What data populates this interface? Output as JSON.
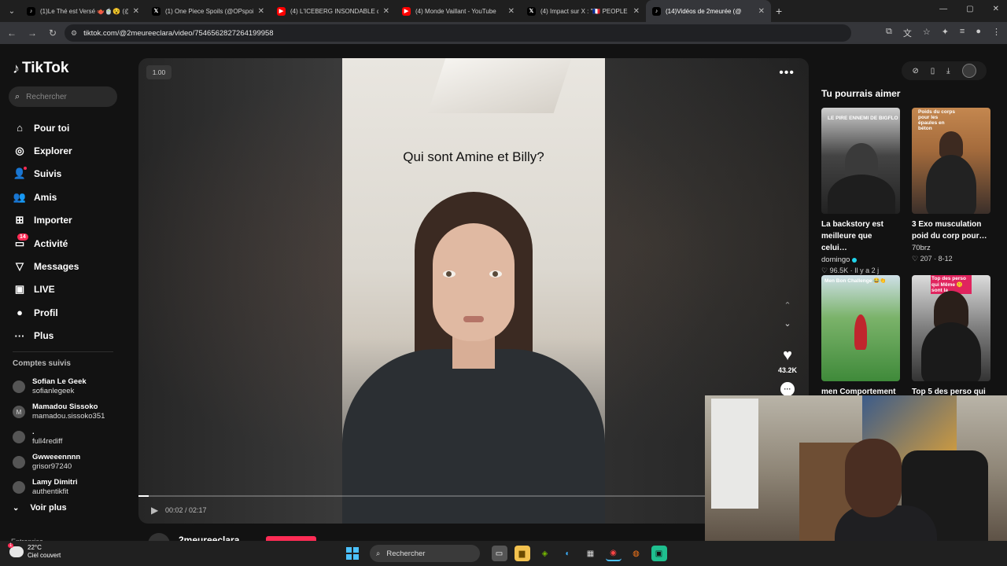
{
  "browser": {
    "tabs": [
      {
        "title": "(1)Le Thé est Versé 🫖🍵😵 (@",
        "favicon": "tiktok"
      },
      {
        "title": "(1) One Piece Spoils (@OPspoi",
        "favicon": "x"
      },
      {
        "title": "(4) L'ICEBERG INSONDABLE de",
        "favicon": "youtube"
      },
      {
        "title": "(4) Monde Vaillant - YouTube",
        "favicon": "youtube"
      },
      {
        "title": "(4) Impact sur X : \"🇫🇷 PEOPLE | A",
        "favicon": "x"
      },
      {
        "title": "(14)Vidéos de 2meurée (@",
        "favicon": "tiktok",
        "active": true
      }
    ],
    "url": "tiktok.com/@2meureeclara/video/7546562827264199958"
  },
  "tiktok": {
    "logo": "TikTok",
    "search_placeholder": "Rechercher",
    "nav": [
      {
        "label": "Pour toi",
        "icon": "home-icon",
        "glyph": "⌂"
      },
      {
        "label": "Explorer",
        "icon": "compass-icon",
        "glyph": "◎"
      },
      {
        "label": "Suivis",
        "icon": "following-icon",
        "glyph": "👤"
      },
      {
        "label": "Amis",
        "icon": "friends-icon",
        "glyph": "👥"
      },
      {
        "label": "Importer",
        "icon": "upload-icon",
        "glyph": "⊞"
      },
      {
        "label": "Activité",
        "icon": "activity-icon",
        "glyph": "▭",
        "badge": "14"
      },
      {
        "label": "Messages",
        "icon": "messages-icon",
        "glyph": "▽"
      },
      {
        "label": "LIVE",
        "icon": "live-icon",
        "glyph": "▣"
      },
      {
        "label": "Profil",
        "icon": "profile-icon",
        "glyph": "●"
      },
      {
        "label": "Plus",
        "icon": "more-icon",
        "glyph": "···"
      }
    ],
    "followed_title": "Comptes suivis",
    "followed": [
      {
        "name": "Sofian Le Geek",
        "username": "sofianlegeek",
        "initial": ""
      },
      {
        "name": "Mamadou Sissoko",
        "username": "mamadou.sissoko351",
        "initial": "M"
      },
      {
        "name": ".",
        "username": "full4rediff",
        "initial": ""
      },
      {
        "name": "Gwweeennnn",
        "username": "grisor97240",
        "initial": ""
      },
      {
        "name": "Lamy Dimitri",
        "username": "authentikfit",
        "initial": ""
      }
    ],
    "see_more": "Voir plus",
    "footer_partial": "Entreprise",
    "video": {
      "speed": "1.00",
      "caption": "Qui sont Amine et Billy?",
      "likes": "43.2K",
      "time": "00:02 / 02:17",
      "progress": 0.015,
      "author": "2meureeclara"
    },
    "recommendations_title": "Tu pourrais aimer",
    "recommendations": [
      {
        "title": "La backstory est meilleure que celui…",
        "author": "domingo",
        "verified": true,
        "meta": "♡ 96.5K · Il y a 2 j",
        "overlay": "LE PIRE ENNEMI DE BIGFLO"
      },
      {
        "title": "3 Exo musculation poid du corp pour…",
        "author": "70brz",
        "verified": false,
        "meta": "♡ 207 · 8-12",
        "overlay": "Poids du corps pour les épaules en béton"
      },
      {
        "title": "men Comportement",
        "author": "",
        "verified": false,
        "meta": "",
        "overlay": "Men Bon Challenge 😂👏"
      },
      {
        "title": "Top 5 des perso qui",
        "author": "",
        "verified": false,
        "meta": "",
        "overlay": "Top des perso qui Même 🤫 sont la"
      }
    ]
  },
  "taskbar": {
    "weather_temp": "22°C",
    "weather_desc": "Ciel couvert",
    "weather_badge": "1",
    "search_placeholder": "Rechercher"
  }
}
